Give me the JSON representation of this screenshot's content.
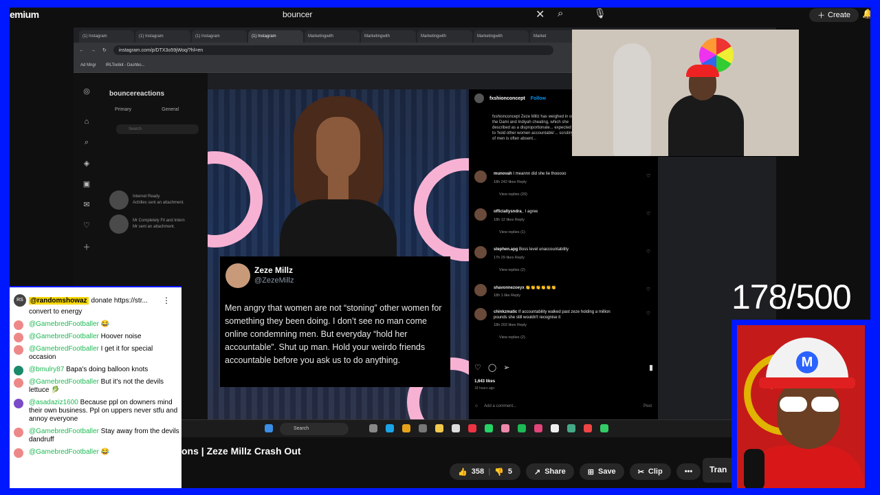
{
  "youtube": {
    "brand": "emium",
    "search_query": "bouncer",
    "create_label": "Create"
  },
  "browser": {
    "tabs": [
      "(1) Instagram",
      "(1) Instagram",
      "(1) Instagram",
      "(1) Instagram",
      "Marketingwith",
      "Marketingwith",
      "Marketingwith",
      "Marketingwith",
      "Market"
    ],
    "url": "instagram.com/p/DTX3o59jWoq/?hl=en",
    "bookmarks": [
      "Ad Mngr",
      "IRLToolkit - Dashbo..."
    ]
  },
  "instagram": {
    "username": "bouncereactions",
    "tabs": [
      "Primary",
      "General"
    ],
    "search_placeholder": "Search",
    "messages": [
      {
        "name": "Internet Ready",
        "preview": "Achilles sent an attachment."
      },
      {
        "name": "Mr Completely Fit and Intern",
        "preview": "Mr sent an attachment."
      }
    ],
    "post_account": "fxshionconcept",
    "follow": "Follow",
    "caption": "fxshionconcept Zeze Millz has weighed in on the Dami and Indiyah cheating, which she described as a disproportionate... expected to 'hold other women accountable'... scrutiny of men is often absent...",
    "comments": [
      {
        "user": "munovah",
        "text": "I meannn did she lie thooooo",
        "meta": "18h  242 likes  Reply",
        "replies": "View replies (20)"
      },
      {
        "user": "officiallysndra_",
        "text": "I agree",
        "meta": "18h  12 likes  Reply",
        "replies": "View replies (1)"
      },
      {
        "user": "stephen.apg",
        "text": "Boss level unaccountability",
        "meta": "17h  29 likes  Reply",
        "replies": "View replies (2)"
      },
      {
        "user": "shavonnezoeyx",
        "text": "👏👏👏👏👏👏",
        "meta": "18h  1 like  Reply",
        "replies": ""
      },
      {
        "user": "chinkzmatic",
        "text": "If accountability walked past zeze holding a million pounds she still wouldn't recognise it",
        "meta": "18h  202 likes  Reply",
        "replies": "View replies (2)"
      }
    ],
    "likes": "1,643 likes",
    "ago": "18 hours ago",
    "add_comment": "Add a comment...",
    "post_btn": "Post"
  },
  "tweet": {
    "name": "Zeze Millz",
    "handle": "@ZezeMillz",
    "text": "Men angry that women are not “stoning” other women for something they been doing. I don’t see no man come online condemning men. But everyday “hold her accountable”. Shut up man. Hold your weirdo friends accountable before you ask us to do anything."
  },
  "taskbar": {
    "search": "Search"
  },
  "counter": "178/500",
  "chat": {
    "pinned_user": "@randomshowaz",
    "pinned_text": "donate https://str...",
    "lines": [
      {
        "user": "",
        "text": "convert to energy"
      },
      {
        "user": "@GamebredFootballer",
        "text": "😂"
      },
      {
        "user": "@GamebredFootballer",
        "text": "Hoover noise"
      },
      {
        "user": "@GamebredFootballer",
        "text": "I get it for special occasion"
      },
      {
        "user": "@bmulry87",
        "text": "Bapa's doing balloon knots"
      },
      {
        "user": "@GamebredFootballer",
        "text": "But it's not the devils lettuce 🥬"
      },
      {
        "user": "@asadaziz1600",
        "text": "Because ppl on downers mind their own business. Ppl on uppers never stfu and annoy everyone"
      },
      {
        "user": "@GamebredFootballer",
        "text": "Stay away from the devils dandruff"
      },
      {
        "user": "@GamebredFootballer",
        "text": "😂"
      }
    ]
  },
  "video": {
    "title": "ons | Zeze Millz Crash Out",
    "likes": "358",
    "dislikes": "5",
    "share": "Share",
    "save": "Save",
    "clip": "Clip",
    "more": "•••",
    "transcript": "Tran"
  }
}
